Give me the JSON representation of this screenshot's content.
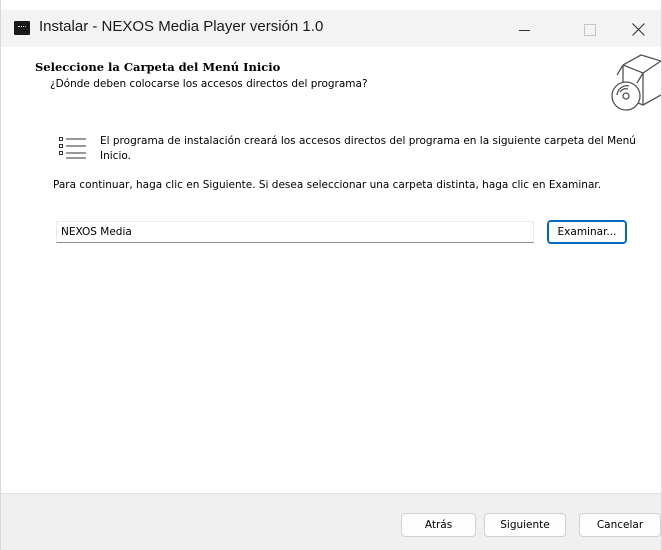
{
  "window": {
    "title": "Instalar - NEXOS Media Player versión 1.0",
    "app_icon": "nexos-app-icon",
    "controls": {
      "minimize_icon": "minimize-icon",
      "maximize_icon": "maximize-icon",
      "close_icon": "close-icon"
    }
  },
  "header": {
    "title": "Seleccione la Carpeta del Menú Inicio",
    "subtitle": "¿Dónde deben colocarse los accesos directos del programa?",
    "icon": "software-box-icon"
  },
  "content": {
    "description_icon": "shortcut-list-icon",
    "description": "El programa de instalación creará los accesos directos del programa en la siguiente carpeta del Menú Inicio.",
    "instruction": "Para continuar, haga clic en Siguiente. Si desea seleccionar una carpeta distinta, haga clic en Examinar.",
    "folder_value": "NEXOS Media",
    "browse_label": "Examinar..."
  },
  "footer": {
    "back_label": "Atrás",
    "next_label": "Siguiente",
    "cancel_label": "Cancelar"
  },
  "colors": {
    "accent": "#0067c0",
    "titlebar_bg": "#f3f3f3",
    "footer_bg": "#f0f0f0"
  }
}
